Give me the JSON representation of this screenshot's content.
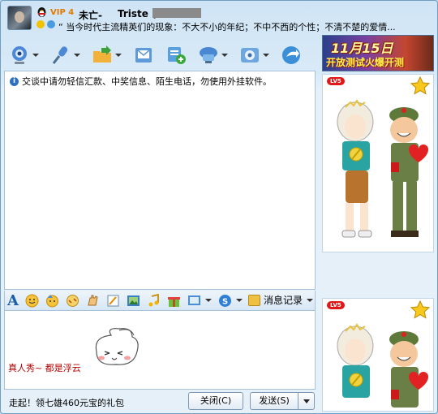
{
  "header": {
    "vip": "VIP 4",
    "nickname": "未亡-",
    "buddy_name": "Triste (",
    "signature": "“ 当今时代主流精英们的现象：不大不小的年纪；不中不西的个性；不清不楚的爱情..."
  },
  "toolbar": {
    "icons": [
      "webcam-icon",
      "microphone-icon",
      "file-transfer-icon",
      "email-icon",
      "add-app-icon",
      "remote-assist-icon",
      "settings-icon",
      "share-icon"
    ]
  },
  "chat": {
    "notice": "交谈中请勿轻信汇款、中奖信息、陌生电话，勿使用外挂软件。"
  },
  "input_toolbar": {
    "message_record_label": "消息记录"
  },
  "input": {
    "text": "真人秀~ 都是浮云"
  },
  "footer": {
    "ad_text": "走起！领七雄460元宝的礼包",
    "close_label": "关闭(C)",
    "send_label": "发送(S)"
  },
  "right_panel": {
    "ad_date": "11月15日",
    "ad_sub": "开放测试火爆开测",
    "level_badge": "LV5",
    "level_badge_2": "LV5"
  },
  "colors": {
    "window_bg": "#d9eaf7",
    "border": "#a7c3dc",
    "input_text": "#b00000"
  }
}
